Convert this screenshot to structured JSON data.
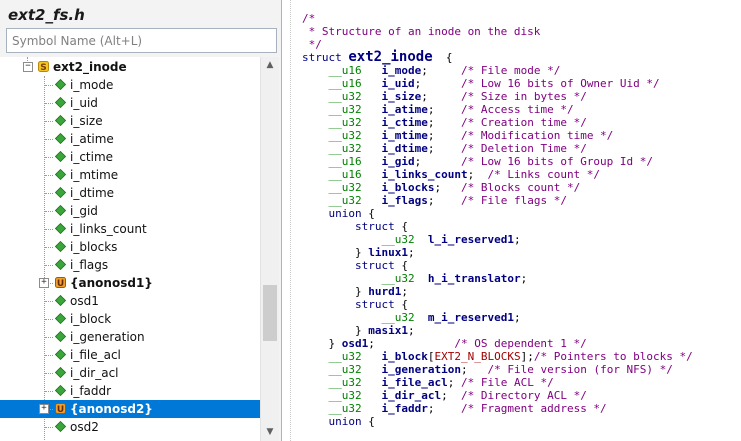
{
  "file_title": "ext2_fs.h",
  "search": {
    "placeholder": "Symbol Name (Alt+L)"
  },
  "tree": {
    "selected_index": 19,
    "items": [
      {
        "label": "ext2_inode",
        "kind": "struct",
        "depth": 0,
        "expander": "minus",
        "bold": true
      },
      {
        "label": "i_mode",
        "kind": "field",
        "depth": 1
      },
      {
        "label": "i_uid",
        "kind": "field",
        "depth": 1
      },
      {
        "label": "i_size",
        "kind": "field",
        "depth": 1
      },
      {
        "label": "i_atime",
        "kind": "field",
        "depth": 1
      },
      {
        "label": "i_ctime",
        "kind": "field",
        "depth": 1
      },
      {
        "label": "i_mtime",
        "kind": "field",
        "depth": 1
      },
      {
        "label": "i_dtime",
        "kind": "field",
        "depth": 1
      },
      {
        "label": "i_gid",
        "kind": "field",
        "depth": 1
      },
      {
        "label": "i_links_count",
        "kind": "field",
        "depth": 1
      },
      {
        "label": "i_blocks",
        "kind": "field",
        "depth": 1
      },
      {
        "label": "i_flags",
        "kind": "field",
        "depth": 1
      },
      {
        "label": "{anonosd1}",
        "kind": "union",
        "depth": 1,
        "expander": "plus",
        "bold": true
      },
      {
        "label": "osd1",
        "kind": "field",
        "depth": 1
      },
      {
        "label": "i_block",
        "kind": "field",
        "depth": 1
      },
      {
        "label": "i_generation",
        "kind": "field",
        "depth": 1
      },
      {
        "label": "i_file_acl",
        "kind": "field",
        "depth": 1
      },
      {
        "label": "i_dir_acl",
        "kind": "field",
        "depth": 1
      },
      {
        "label": "i_faddr",
        "kind": "field",
        "depth": 1
      },
      {
        "label": "{anonosd2}",
        "kind": "union",
        "depth": 1,
        "expander": "plus",
        "bold": true
      },
      {
        "label": "osd2",
        "kind": "field",
        "depth": 1
      }
    ]
  },
  "code": {
    "lines": [
      [
        [
          "cm",
          "/*"
        ]
      ],
      [
        [
          "cm",
          " * Structure of an inode on the disk"
        ]
      ],
      [
        [
          "cm",
          " */"
        ]
      ],
      [
        [
          "kw",
          "struct "
        ],
        [
          "big",
          "ext2_inode"
        ],
        [
          "",
          "  {"
        ]
      ],
      [
        [
          "",
          "    "
        ],
        [
          "ty",
          "__u16"
        ],
        [
          "",
          "   "
        ],
        [
          "nm",
          "i_mode"
        ],
        [
          "",
          ";     "
        ],
        [
          "cm",
          "/* File mode */"
        ]
      ],
      [
        [
          "",
          "    "
        ],
        [
          "ty",
          "__u16"
        ],
        [
          "",
          "   "
        ],
        [
          "nm",
          "i_uid"
        ],
        [
          "",
          ";      "
        ],
        [
          "cm",
          "/* Low 16 bits of Owner Uid */"
        ]
      ],
      [
        [
          "",
          "    "
        ],
        [
          "ty",
          "__u32"
        ],
        [
          "",
          "   "
        ],
        [
          "nm",
          "i_size"
        ],
        [
          "",
          ";     "
        ],
        [
          "cm",
          "/* Size in bytes */"
        ]
      ],
      [
        [
          "",
          "    "
        ],
        [
          "ty",
          "__u32"
        ],
        [
          "",
          "   "
        ],
        [
          "nm",
          "i_atime"
        ],
        [
          "",
          ";    "
        ],
        [
          "cm",
          "/* Access time */"
        ]
      ],
      [
        [
          "",
          "    "
        ],
        [
          "ty",
          "__u32"
        ],
        [
          "",
          "   "
        ],
        [
          "nm",
          "i_ctime"
        ],
        [
          "",
          ";    "
        ],
        [
          "cm",
          "/* Creation time */"
        ]
      ],
      [
        [
          "",
          "    "
        ],
        [
          "ty",
          "__u32"
        ],
        [
          "",
          "   "
        ],
        [
          "nm",
          "i_mtime"
        ],
        [
          "",
          ";    "
        ],
        [
          "cm",
          "/* Modification time */"
        ]
      ],
      [
        [
          "",
          "    "
        ],
        [
          "ty",
          "__u32"
        ],
        [
          "",
          "   "
        ],
        [
          "nm",
          "i_dtime"
        ],
        [
          "",
          ";    "
        ],
        [
          "cm",
          "/* Deletion Time */"
        ]
      ],
      [
        [
          "",
          "    "
        ],
        [
          "ty",
          "__u16"
        ],
        [
          "",
          "   "
        ],
        [
          "nm",
          "i_gid"
        ],
        [
          "",
          ";      "
        ],
        [
          "cm",
          "/* Low 16 bits of Group Id */"
        ]
      ],
      [
        [
          "",
          "    "
        ],
        [
          "ty",
          "__u16"
        ],
        [
          "",
          "   "
        ],
        [
          "nm",
          "i_links_count"
        ],
        [
          "",
          ";  "
        ],
        [
          "cm",
          "/* Links count */"
        ]
      ],
      [
        [
          "",
          "    "
        ],
        [
          "ty",
          "__u32"
        ],
        [
          "",
          "   "
        ],
        [
          "nm",
          "i_blocks"
        ],
        [
          "",
          ";   "
        ],
        [
          "cm",
          "/* Blocks count */"
        ]
      ],
      [
        [
          "",
          "    "
        ],
        [
          "ty",
          "__u32"
        ],
        [
          "",
          "   "
        ],
        [
          "nm",
          "i_flags"
        ],
        [
          "",
          ";    "
        ],
        [
          "cm",
          "/* File flags */"
        ]
      ],
      [
        [
          "",
          "    "
        ],
        [
          "kw",
          "union"
        ],
        [
          "",
          " {"
        ]
      ],
      [
        [
          "",
          "        "
        ],
        [
          "kw",
          "struct"
        ],
        [
          "",
          " {"
        ]
      ],
      [
        [
          "",
          "            "
        ],
        [
          "ty",
          "__u32"
        ],
        [
          "",
          "  "
        ],
        [
          "nm",
          "l_i_reserved1"
        ],
        [
          "",
          ";"
        ]
      ],
      [
        [
          "",
          "        } "
        ],
        [
          "nm",
          "linux1"
        ],
        [
          "",
          ";"
        ]
      ],
      [
        [
          "",
          "        "
        ],
        [
          "kw",
          "struct"
        ],
        [
          "",
          " {"
        ]
      ],
      [
        [
          "",
          "            "
        ],
        [
          "ty",
          "__u32"
        ],
        [
          "",
          "  "
        ],
        [
          "nm",
          "h_i_translator"
        ],
        [
          "",
          ";"
        ]
      ],
      [
        [
          "",
          "        } "
        ],
        [
          "nm",
          "hurd1"
        ],
        [
          "",
          ";"
        ]
      ],
      [
        [
          "",
          "        "
        ],
        [
          "kw",
          "struct"
        ],
        [
          "",
          " {"
        ]
      ],
      [
        [
          "",
          "            "
        ],
        [
          "ty",
          "__u32"
        ],
        [
          "",
          "  "
        ],
        [
          "nm",
          "m_i_reserved1"
        ],
        [
          "",
          ";"
        ]
      ],
      [
        [
          "",
          "        } "
        ],
        [
          "nm",
          "masix1"
        ],
        [
          "",
          ";"
        ]
      ],
      [
        [
          "",
          "    } "
        ],
        [
          "nm",
          "osd1"
        ],
        [
          "",
          ";            "
        ],
        [
          "cm",
          "/* OS dependent 1 */"
        ]
      ],
      [
        [
          "",
          "    "
        ],
        [
          "ty",
          "__u32"
        ],
        [
          "",
          "   "
        ],
        [
          "nm",
          "i_block"
        ],
        [
          "",
          "["
        ],
        [
          "mac",
          "EXT2_N_BLOCKS"
        ],
        [
          "",
          "];"
        ],
        [
          "cm",
          "/* Pointers to blocks */"
        ]
      ],
      [
        [
          "",
          "    "
        ],
        [
          "ty",
          "__u32"
        ],
        [
          "",
          "   "
        ],
        [
          "nm",
          "i_generation"
        ],
        [
          "",
          ";   "
        ],
        [
          "cm",
          "/* File version (for NFS) */"
        ]
      ],
      [
        [
          "",
          "    "
        ],
        [
          "ty",
          "__u32"
        ],
        [
          "",
          "   "
        ],
        [
          "nm",
          "i_file_acl"
        ],
        [
          "",
          "; "
        ],
        [
          "cm",
          "/* File ACL */"
        ]
      ],
      [
        [
          "",
          "    "
        ],
        [
          "ty",
          "__u32"
        ],
        [
          "",
          "   "
        ],
        [
          "nm",
          "i_dir_acl"
        ],
        [
          "",
          ";  "
        ],
        [
          "cm",
          "/* Directory ACL */"
        ]
      ],
      [
        [
          "",
          "    "
        ],
        [
          "ty",
          "__u32"
        ],
        [
          "",
          "   "
        ],
        [
          "nm",
          "i_faddr"
        ],
        [
          "",
          ";    "
        ],
        [
          "cm",
          "/* Fragment address */"
        ]
      ],
      [
        [
          "",
          "    "
        ],
        [
          "kw",
          "union"
        ],
        [
          "",
          " {"
        ]
      ]
    ]
  }
}
